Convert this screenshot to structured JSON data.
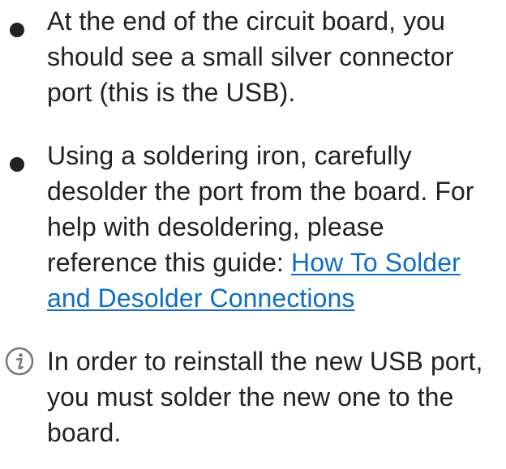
{
  "steps": [
    {
      "bullet": "bullet",
      "text": "At the end of the circuit board, you should see a small silver connector port (this is the USB)."
    },
    {
      "bullet": "bullet",
      "text_before_link": "Using a soldering iron, carefully desolder the port from the board. For help with desoldering, please reference this guide: ",
      "link_text": "How To Solder and Desolder Connections"
    },
    {
      "bullet": "info",
      "icon": "info-icon",
      "text": "In order to reinstall the new USB port, you must solder the new one to the board."
    }
  ],
  "colors": {
    "text": "#222222",
    "link": "#0f6dc4",
    "bullet": "#222222",
    "info_icon": "#777777"
  }
}
